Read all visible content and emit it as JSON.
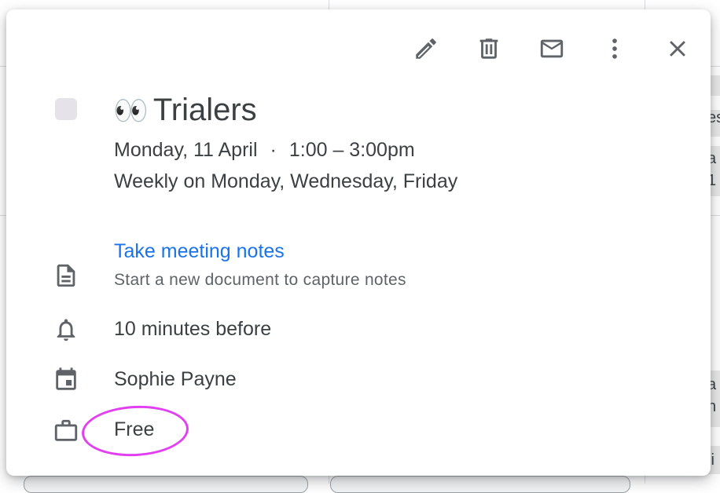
{
  "background": {
    "peek_texts": [
      "es",
      "a",
      "1",
      "a",
      "n",
      "li"
    ]
  },
  "toolbar": {
    "edit_icon": "pencil-icon",
    "delete_icon": "trash-icon",
    "email_icon": "mail-icon",
    "more_icon": "more-vert-icon",
    "close_icon": "close-icon"
  },
  "event": {
    "color": "#e6e2ea",
    "emoji": "👀",
    "title": "Trialers",
    "date": "Monday, 11 April",
    "separator": "·",
    "time": "1:00 – 3:00pm",
    "recurrence": "Weekly on Monday, Wednesday, Friday"
  },
  "notes": {
    "link_label": "Take meeting notes",
    "subtitle": "Start a new document to capture notes",
    "link_color": "#1a73e8"
  },
  "reminder": {
    "text": "10 minutes before"
  },
  "organizer": {
    "name": "Sophie Payne"
  },
  "availability": {
    "status": "Free"
  },
  "annotation": {
    "color": "#e23ff0"
  }
}
